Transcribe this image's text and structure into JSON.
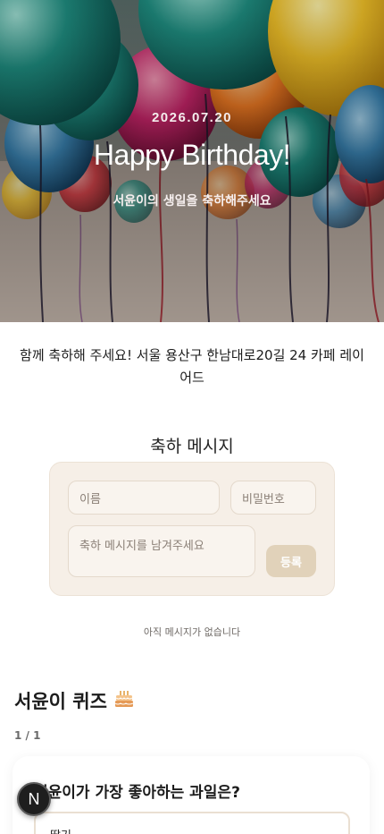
{
  "hero": {
    "date": "2026.07.20",
    "title": "Happy Birthday!",
    "subtitle": "서윤이의 생일을 축하해주세요"
  },
  "location": {
    "text": "함께 축하해 주세요! 서울 용산구 한남대로20길 24 카페 레이어드"
  },
  "guestbook": {
    "title": "축하 메시지",
    "name_placeholder": "이름",
    "password_placeholder": "비밀번호",
    "message_placeholder": "축하 메시지를 남겨주세요",
    "submit_label": "등록",
    "empty_text": "아직 메시지가 없습니다"
  },
  "quiz": {
    "title": "서윤이 퀴즈",
    "title_icon": "cake-icon",
    "page": "1 / 1",
    "question": "서윤이가 가장 좋아하는 과일은?",
    "options": [
      "딸기"
    ]
  },
  "fab": {
    "label": "N"
  },
  "colors": {
    "card_bg": "#f6efe7",
    "button_bg": "#e1d2ba",
    "fab_bg": "#1e1e1e"
  }
}
